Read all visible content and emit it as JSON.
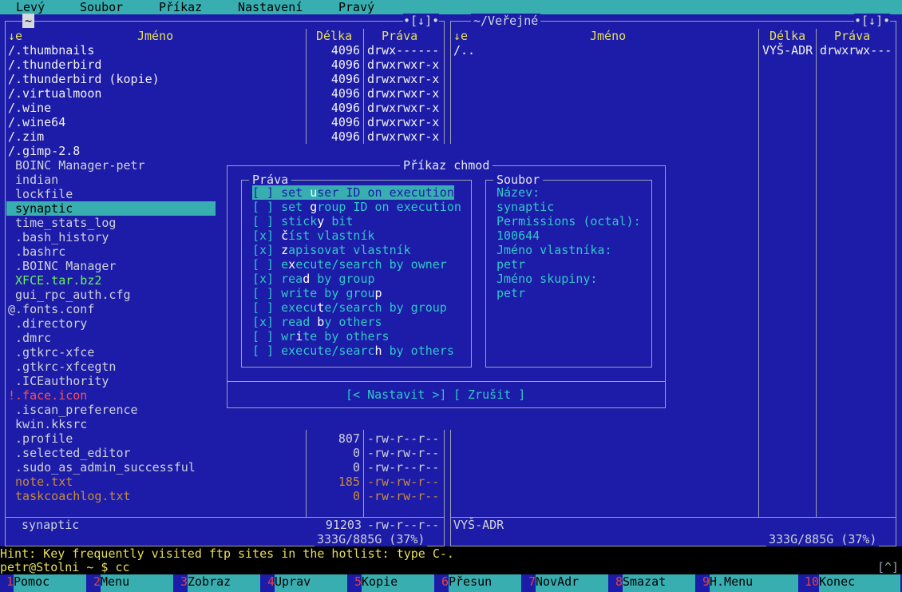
{
  "menubar": {
    "items": [
      "Levý",
      "Soubor",
      "Příkaz",
      "Nastavení",
      "Pravý"
    ]
  },
  "left_panel": {
    "path": "~",
    "controls": "•[↓]•",
    "columns": {
      "sort": "↓e",
      "name": "Jméno",
      "size": "Délka",
      "perms": "Práva"
    },
    "files": [
      {
        "name": "/.thumbnails",
        "size": "4096",
        "perms": "drwx------",
        "color": "#f1f1f1"
      },
      {
        "name": "/.thunderbird",
        "size": "4096",
        "perms": "drwxrwxr-x",
        "color": "#f1f1f1"
      },
      {
        "name": "/.thunderbird (kopie)",
        "size": "4096",
        "perms": "drwxrwxr-x",
        "color": "#f1f1f1"
      },
      {
        "name": "/.virtualmoon",
        "size": "4096",
        "perms": "drwxrwxr-x",
        "color": "#f1f1f1"
      },
      {
        "name": "/.wine",
        "size": "4096",
        "perms": "drwxrwxr-x",
        "color": "#f1f1f1"
      },
      {
        "name": "/.wine64",
        "size": "4096",
        "perms": "drwxrwxr-x",
        "color": "#f1f1f1"
      },
      {
        "name": "/.zim",
        "size": "4096",
        "perms": "drwxrwxr-x",
        "color": "#f1f1f1"
      },
      {
        "name": "/.gimp-2.8",
        "size": "",
        "perms": "",
        "color": "#f1f1f1"
      },
      {
        "name": " BOINC Manager-petr",
        "size": "",
        "perms": "",
        "color": "#cfd1da"
      },
      {
        "name": " indian",
        "size": "",
        "perms": "",
        "color": "#cfd1da"
      },
      {
        "name": " lockfile",
        "size": "",
        "perms": "",
        "color": "#cfd1da"
      },
      {
        "name": " synaptic",
        "size": "",
        "perms": "",
        "color": "#000000"
      },
      {
        "name": " time_stats_log",
        "size": "",
        "perms": "",
        "color": "#cfd1da"
      },
      {
        "name": " .bash_history",
        "size": "",
        "perms": "",
        "color": "#cfd1da"
      },
      {
        "name": " .bashrc",
        "size": "",
        "perms": "",
        "color": "#cfd1da"
      },
      {
        "name": " .BOINC Manager",
        "size": "",
        "perms": "",
        "color": "#cfd1da"
      },
      {
        "name": " XFCE.tar.bz2",
        "size": "",
        "perms": "",
        "color": "#6ff05b"
      },
      {
        "name": " gui_rpc_auth.cfg",
        "size": "",
        "perms": "",
        "color": "#cfd1da"
      },
      {
        "name": "@.fonts.conf",
        "size": "",
        "perms": "",
        "color": "#cfd1da"
      },
      {
        "name": " .directory",
        "size": "",
        "perms": "",
        "color": "#cfd1da"
      },
      {
        "name": " .dmrc",
        "size": "",
        "perms": "",
        "color": "#cfd1da"
      },
      {
        "name": " .gtkrc-xfce",
        "size": "",
        "perms": "",
        "color": "#cfd1da"
      },
      {
        "name": " .gtkrc-xfcegtn",
        "size": "",
        "perms": "",
        "color": "#cfd1da"
      },
      {
        "name": " .ICEauthority",
        "size": "",
        "perms": "",
        "color": "#cfd1da"
      },
      {
        "name": "!.face.icon",
        "size": "",
        "perms": "",
        "color": "#ff5050"
      },
      {
        "name": " .iscan_preference",
        "size": "",
        "perms": "",
        "color": "#cfd1da"
      },
      {
        "name": " kwin.kksrc",
        "size": "",
        "perms": "",
        "color": "#cfd1da"
      },
      {
        "name": " .profile",
        "size": "807",
        "perms": "-rw-r--r--",
        "color": "#cfd1da"
      },
      {
        "name": " .selected_editor",
        "size": "0",
        "perms": "-rw-rw-r--",
        "color": "#cfd1da"
      },
      {
        "name": " .sudo_as_admin_successful",
        "size": "0",
        "perms": "-rw-r--r--",
        "color": "#cfd1da"
      },
      {
        "name": " note.txt",
        "size": "185",
        "perms": "-rw-rw-r--",
        "color": "#c88a3a"
      },
      {
        "name": " taskcoachlog.txt",
        "size": "0",
        "perms": "-rw-rw-r--",
        "color": "#c88a3a"
      }
    ],
    "selected_index": 11,
    "status": {
      "name": " synaptic",
      "size": "91203",
      "perms": "-rw-r--r--"
    },
    "disk": "333G/885G (37%)"
  },
  "right_panel": {
    "path": "~/Veřejné",
    "controls": "•[↓]•",
    "columns": {
      "sort": "↓e",
      "name": "Jméno",
      "size": "Délka",
      "perms": "Práva"
    },
    "files": [
      {
        "name": "/..",
        "size": "VYŠ-ADR",
        "perms": "drwxrwx---"
      }
    ],
    "status": "VYŠ-ADR",
    "disk": "333G/885G (37%)"
  },
  "dialog": {
    "title": "Příkaz chmod",
    "rights_label": "Práva",
    "file_label": "Soubor",
    "checkboxes": [
      {
        "box": "[ ]",
        "pre": " set ",
        "hot": "u",
        "post": "ser ID on execution",
        "selected": true
      },
      {
        "box": "[ ]",
        "pre": " set ",
        "hot": "g",
        "post": "roup ID on execution",
        "selected": false
      },
      {
        "box": "[ ]",
        "pre": " stick",
        "hot": "y",
        "post": " bit",
        "selected": false
      },
      {
        "box": "[x]",
        "pre": " ",
        "hot": "č",
        "post": "íst vlastník",
        "selected": false
      },
      {
        "box": "[x]",
        "pre": " ",
        "hot": "z",
        "post": "apisovat vlastník",
        "selected": false
      },
      {
        "box": "[ ]",
        "pre": " e",
        "hot": "x",
        "post": "ecute/search by owner",
        "selected": false
      },
      {
        "box": "[x]",
        "pre": " rea",
        "hot": "d",
        "post": " by group",
        "selected": false
      },
      {
        "box": "[ ]",
        "pre": " write by grou",
        "hot": "p",
        "post": "",
        "selected": false
      },
      {
        "box": "[ ]",
        "pre": " execu",
        "hot": "t",
        "post": "e/search by group",
        "selected": false
      },
      {
        "box": "[x]",
        "pre": " read ",
        "hot": "b",
        "post": "y others",
        "selected": false
      },
      {
        "box": "[ ]",
        "pre": " wr",
        "hot": "i",
        "post": "te by others",
        "selected": false
      },
      {
        "box": "[ ]",
        "pre": " execute/searc",
        "hot": "h",
        "post": " by others",
        "selected": false
      }
    ],
    "info": [
      "Název:",
      "synaptic",
      "Permissions (octal):",
      "100644",
      "Jméno vlastníka:",
      "petr",
      "Jméno skupiny:",
      "petr"
    ],
    "buttons": {
      "set": "[< Nastavit >]",
      "cancel": "[ Zrušit ]"
    }
  },
  "hint": "Hint: Key frequently visited ftp sites in the hotlist: type C-.",
  "prompt": "petr@Stolni ~ $ cc",
  "prompt_marker": "[^]",
  "fkeys": [
    {
      "num": "1",
      "label": "Pomoc"
    },
    {
      "num": "2",
      "label": "Menu"
    },
    {
      "num": "3",
      "label": "Zobraz"
    },
    {
      "num": "4",
      "label": "Uprav"
    },
    {
      "num": "5",
      "label": "Kopie"
    },
    {
      "num": "6",
      "label": "Přesun"
    },
    {
      "num": "7",
      "label": "NovAdr"
    },
    {
      "num": "8",
      "label": "Smazat"
    },
    {
      "num": "9",
      "label": "H.Menu"
    },
    {
      "num": "10",
      "label": "Konec"
    }
  ],
  "colors": {
    "panel_bg": "#1c1ca8",
    "menubar_bg": "#38aeb1",
    "header_yellow": "#e8df5c",
    "dialog_text": "#31c7c7"
  }
}
